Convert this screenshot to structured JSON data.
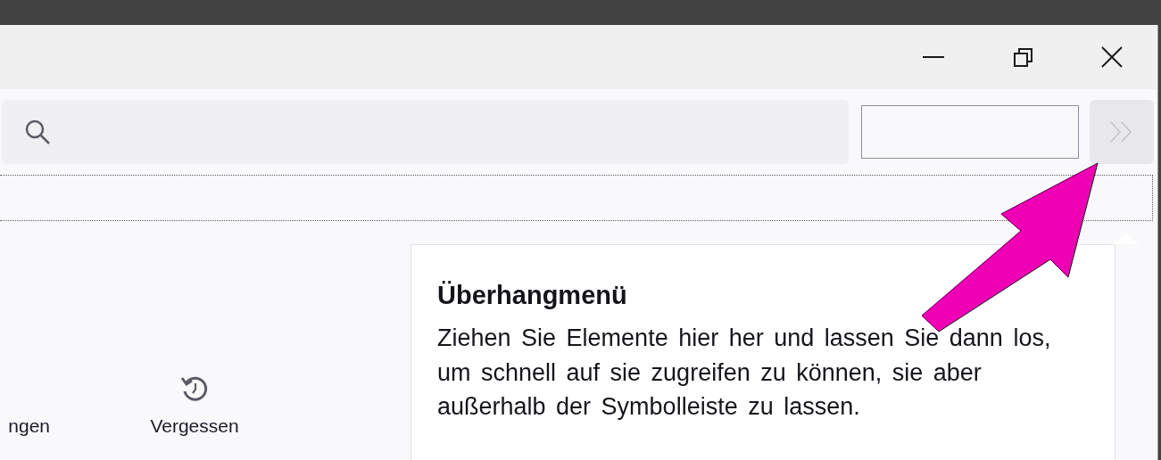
{
  "window": {
    "controls": [
      {
        "kind": "minimize"
      },
      {
        "kind": "restore"
      },
      {
        "kind": "close"
      }
    ]
  },
  "toolbar": {
    "search": {
      "kind": "search"
    },
    "field": {
      "kind": "box"
    },
    "overflow_button": {
      "disabled": true
    }
  },
  "palette": {
    "items": [
      {
        "label": "ngen",
        "kind": "plain"
      },
      {
        "label": "Vergessen",
        "kind": "forget"
      }
    ]
  },
  "popup": {
    "title": "Überhangmenü",
    "text": "Ziehen Sie Elemente hier her und lassen Sie dann los, um schnell auf sie zugreifen zu können, sie aber außerhalb der Symbolleiste zu lassen."
  }
}
